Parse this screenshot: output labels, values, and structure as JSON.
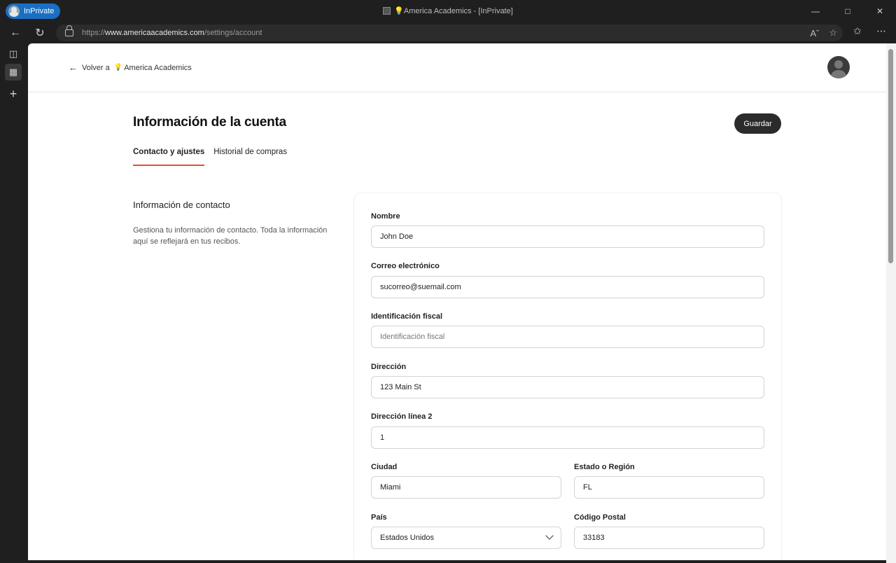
{
  "browser": {
    "inprivate_label": "InPrivate",
    "window_title": "America Academics - [InPrivate]",
    "window_title_prefix": "💡",
    "url_prefix": "https://",
    "url_domain": "www.americaacademics.com",
    "url_path": "/settings/account"
  },
  "header": {
    "back_label": "Volver a",
    "back_bulb": "💡",
    "back_site": "America Academics"
  },
  "page": {
    "title": "Información de la cuenta",
    "save_label": "Guardar",
    "tabs": [
      {
        "label": "Contacto y ajustes",
        "active": true
      },
      {
        "label": "Historial de compras",
        "active": false
      }
    ]
  },
  "contact": {
    "section_title": "Información de contacto",
    "section_desc": "Gestiona tu información de contacto. Toda la información aquí se reflejará en tus recibos.",
    "fields": {
      "name": {
        "label": "Nombre",
        "value": "John Doe"
      },
      "email": {
        "label": "Correo electrónico",
        "value": "sucorreo@suemail.com"
      },
      "tax_id": {
        "label": "Identificación fiscal",
        "placeholder": "Identificación fiscal"
      },
      "address": {
        "label": "Dirección",
        "value": "123 Main St"
      },
      "address2": {
        "label": "Dirección línea 2",
        "value": "1"
      },
      "city": {
        "label": "Ciudad",
        "value": "Miami"
      },
      "state": {
        "label": "Estado o Región",
        "value": "FL"
      },
      "country": {
        "label": "País",
        "value": "Estados Unidos"
      },
      "postal": {
        "label": "Código Postal",
        "value": "33183"
      }
    }
  }
}
